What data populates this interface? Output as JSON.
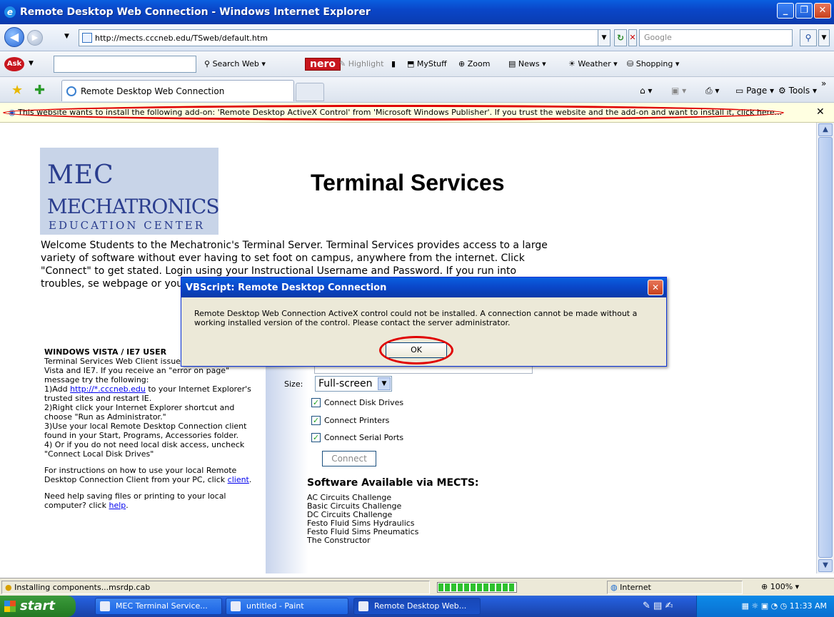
{
  "window": {
    "title": "Remote Desktop Web Connection - Windows Internet Explorer"
  },
  "address": {
    "url": "http://mects.cccneb.edu/TSweb/default.htm",
    "search_placeholder": "Google"
  },
  "toolbar": {
    "search_web": "Search Web",
    "nero": "nero",
    "highlight": "Highlight",
    "mystuff": "MyStuff",
    "zoom": "Zoom",
    "news": "News",
    "weather": "Weather",
    "shopping": "Shopping"
  },
  "tabs": {
    "active": "Remote Desktop Web Connection",
    "page": "Page",
    "tools": "Tools"
  },
  "infobar": {
    "message": "This website wants to install the following add-on: 'Remote Desktop ActiveX Control' from 'Microsoft Windows Publisher'. If you trust the website and the add-on and want to install it, click here..."
  },
  "page": {
    "logo_mec": "MEC",
    "logo_mech": "MECHATRONICS",
    "logo_edu": "EDUCATION CENTER",
    "heading": "Terminal Services",
    "welcome": "Welcome Students to the Mechatronic's Terminal Server. Terminal Services provides access to a large variety of software without ever having to set foot on campus, anywhere from the internet. Click \"Connect\" to get stated. Login using your Instructional Username and Password. If you run into troubles, se webpage or your local Rem",
    "vista_heading": "WINDOWS VISTA / IE7 USER",
    "vista_text": "Terminal Services Web Client issues with Windows Vista and IE7. If you receive an \"error on page\" message try the following:",
    "step1a": " 1)Add ",
    "step1_link": "http://*.cccneb.edu",
    "step1b": " to your Internet Explorer's trusted sites and restart IE.",
    "step2": " 2)Right click your Internet Explorer shortcut and choose \"Run as Administrator.\"",
    "step3": " 3)Use your local Remote Desktop Connection client found in your Start, Programs, Accessories folder.",
    "step4": " 4) Or if you do not need local disk access, uncheck \"Connect Local Disk Drives\"",
    "instr_a": "For instructions on how to use your local Remote Desktop Connection Client from your PC, click ",
    "instr_link": "client",
    "instr_b": ".",
    "help_a": "Need help saving files or printing to your local computer? click ",
    "help_link": "help",
    "help_b": ".",
    "size_label": "Size:",
    "size_value": "Full-screen",
    "cb_disk": "Connect Disk Drives",
    "cb_printers": "Connect Printers",
    "cb_serial": "Connect Serial Ports",
    "connect": "Connect",
    "software_heading": "Software Available via MECTS:",
    "software": [
      "AC Circuits Challenge",
      "Basic Circuits Challenge",
      "DC Circuits Challenge",
      "Festo Fluid Sims Hydraulics",
      "Festo Fluid Sims Pneumatics",
      "The Constructor"
    ]
  },
  "dialog": {
    "title": "VBScript: Remote Desktop Connection",
    "message": "Remote Desktop Web Connection ActiveX control could not be installed. A connection cannot be made without a working installed version of the control. Please contact the server administrator.",
    "ok": "OK"
  },
  "status": {
    "text": "Installing components...msrdp.cab",
    "zone": "Internet",
    "zoom": "100%",
    "progress": 1.0
  },
  "taskbar": {
    "start": "start",
    "tasks": [
      "MEC Terminal Service...",
      "untitled - Paint",
      "Remote Desktop Web..."
    ],
    "clock": "11:33 AM"
  },
  "colors": {
    "titlebar": "#0a46c8",
    "accent_red": "#e00000",
    "taskbar": "#245edb"
  }
}
